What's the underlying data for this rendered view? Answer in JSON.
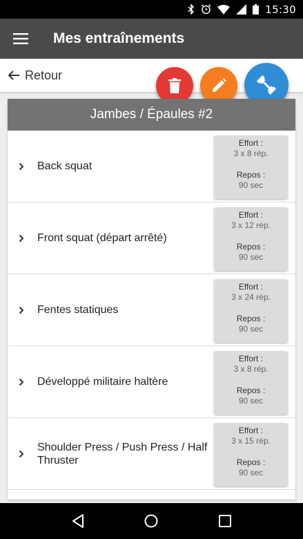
{
  "status": {
    "time": "15:30"
  },
  "header": {
    "title": "Mes entraînements"
  },
  "nav": {
    "back_label": "Retour"
  },
  "workout": {
    "name": "Jambes / Épaules #2",
    "effort_label": "Effort :",
    "rest_label": "Repos :",
    "exercises": [
      {
        "name": "Back squat",
        "effort": "3 x 8 rép.",
        "rest": "90 sec"
      },
      {
        "name": "Front squat (départ arrêté)",
        "effort": "3 x 12 rép.",
        "rest": "90 sec"
      },
      {
        "name": "Fentes statiques",
        "effort": "3 x 24 rép.",
        "rest": "90 sec"
      },
      {
        "name": "Développé militaire haltère",
        "effort": "3 x 8 rép.",
        "rest": "90 sec"
      },
      {
        "name": "Shoulder Press / Push Press / Half Thruster",
        "effort": "3 x 15 rép.",
        "rest": "90 sec"
      }
    ]
  },
  "colors": {
    "delete": "#e53935",
    "edit": "#f57c1f",
    "workout": "#2f8dd6",
    "appbar": "#4a4a4a"
  }
}
